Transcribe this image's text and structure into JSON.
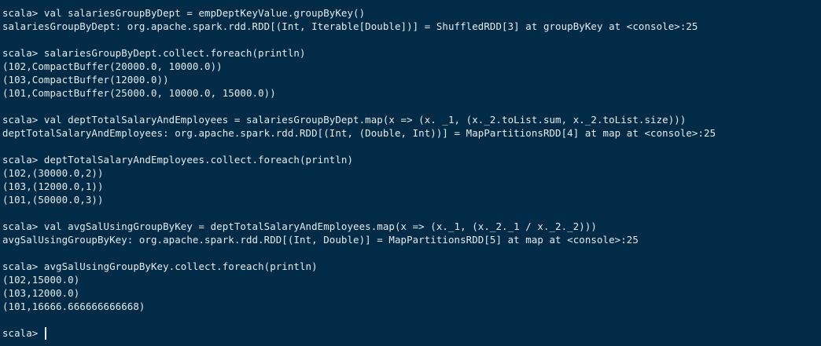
{
  "terminal": {
    "lines": [
      "scala> val salariesGroupByDept = empDeptKeyValue.groupByKey()",
      "salariesGroupByDept: org.apache.spark.rdd.RDD[(Int, Iterable[Double])] = ShuffledRDD[3] at groupByKey at <console>:25",
      "",
      "scala> salariesGroupByDept.collect.foreach(println)",
      "(102,CompactBuffer(20000.0, 10000.0))",
      "(103,CompactBuffer(12000.0))",
      "(101,CompactBuffer(25000.0, 10000.0, 15000.0))",
      "",
      "scala> val deptTotalSalaryAndEmployees = salariesGroupByDept.map(x => (x. _1, (x._2.toList.sum, x._2.toList.size)))",
      "deptTotalSalaryAndEmployees: org.apache.spark.rdd.RDD[(Int, (Double, Int))] = MapPartitionsRDD[4] at map at <console>:25",
      "",
      "scala> deptTotalSalaryAndEmployees.collect.foreach(println)",
      "(102,(30000.0,2))",
      "(103,(12000.0,1))",
      "(101,(50000.0,3))",
      "",
      "scala> val avgSalUsingGroupByKey = deptTotalSalaryAndEmployees.map(x => (x._1, (x._2._1 / x._2._2)))",
      "avgSalUsingGroupByKey: org.apache.spark.rdd.RDD[(Int, Double)] = MapPartitionsRDD[5] at map at <console>:25",
      "",
      "scala> avgSalUsingGroupByKey.collect.foreach(println)",
      "(102,15000.0)",
      "(103,12000.0)",
      "(101,16666.666666666668)",
      ""
    ],
    "prompt": "scala> "
  }
}
